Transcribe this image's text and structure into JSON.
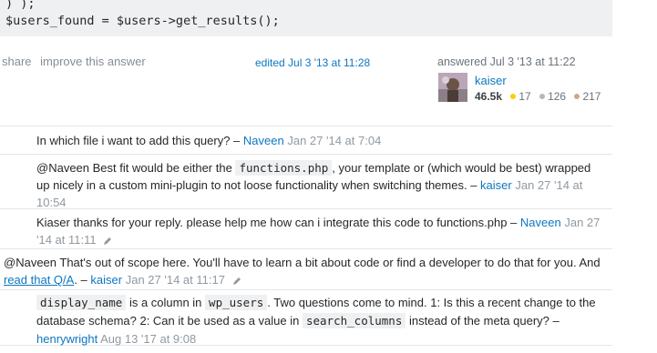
{
  "code": {
    "line1": ") );",
    "line2": "$users_found = $users->get_results();"
  },
  "post_menu": {
    "share": "share",
    "improve": "improve this answer"
  },
  "edited": "edited Jul 3 '13 at 11:28",
  "answered": "answered Jul 3 '13 at 11:22",
  "user": {
    "name": "kaiser",
    "rep": "46.5k",
    "gold": "17",
    "silver": "126",
    "bronze": "217"
  },
  "colors": {
    "link": "#0c77c0",
    "gold": "#ffcc01",
    "silver": "#b4b8bc",
    "bronze": "#d1a684"
  },
  "comments": [
    {
      "text": "In which file i want to add this query? –",
      "user": "Naveen",
      "date": "Jan 27 '14 at 7:04"
    },
    {
      "pre": "@Naveen Best fit would be either the",
      "code": "functions.php",
      "post": ", your template or (which would be best) wrapped up nicely in a custom mini-plugin to not loose functionality when switching themes. –",
      "user": "kaiser",
      "date": "Jan 27 '14 at 10:54"
    },
    {
      "text": "Kiaser thanks for your reply. please help me how can i integrate this code to functions.php –",
      "user": "Naveen",
      "date": "Jan 27 '14 at 11:11"
    },
    {
      "pre": "@Naveen That's out of scope here. You'll have to learn a bit about code or find a developer to do that for you. And",
      "link": "read that Q/A",
      "post": ". –",
      "user": "kaiser",
      "date": "Jan 27 '14 at 11:17"
    },
    {
      "code1": "display_name",
      "t1": "is a column in",
      "code2": "wp_users",
      "t2": ". Two questions come to mind. 1: Is this a recent change to the database schema? 2: Can it be used as a value in",
      "code3": "search_columns",
      "t3": "instead of the meta query? –",
      "user": "henrywright",
      "date": "Aug 13 '17 at 9:08"
    }
  ]
}
